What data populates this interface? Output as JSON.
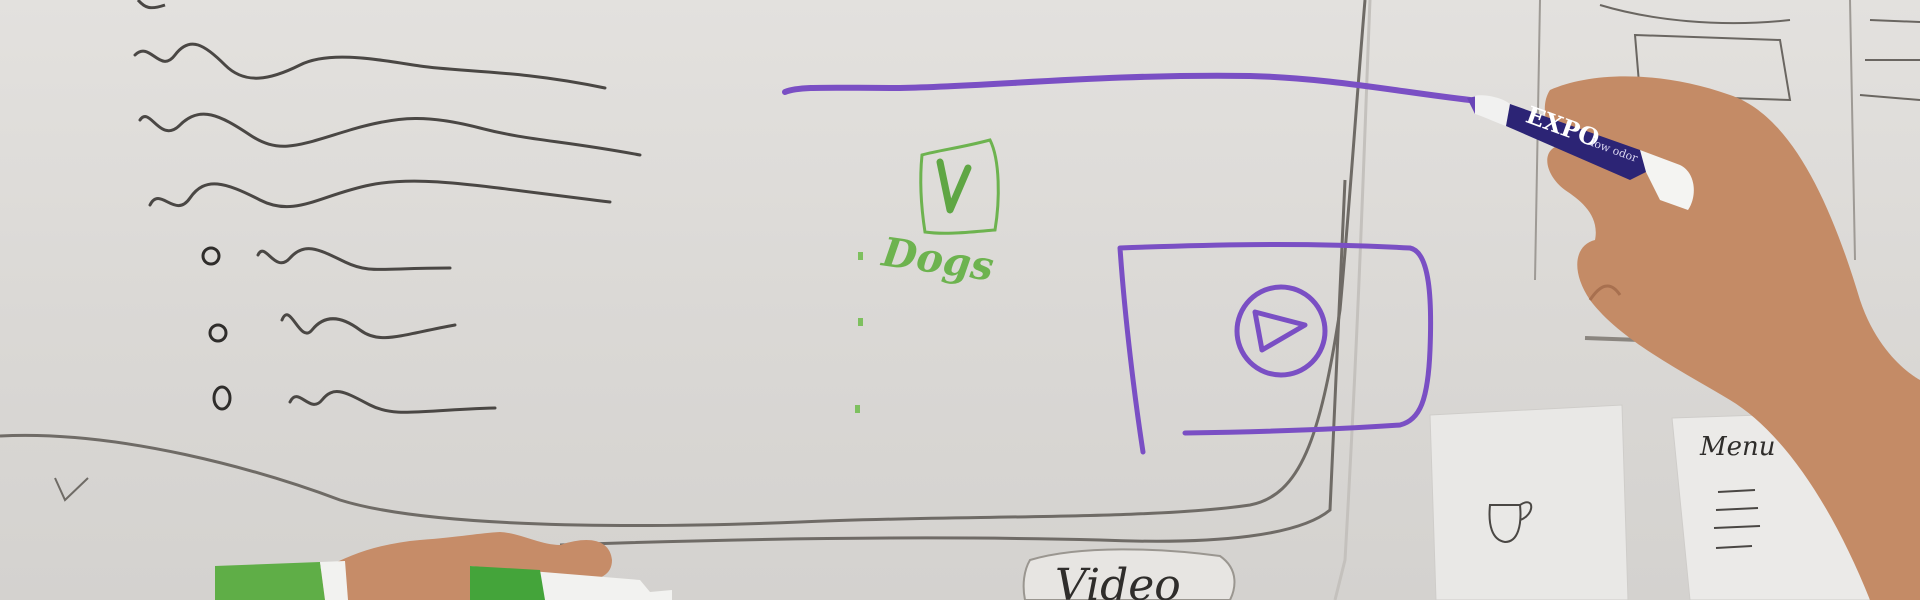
{
  "scene": {
    "description_tag": "whiteboard-ui-wireframe-sketch",
    "colors": {
      "board": "#dcdad7",
      "ink_black": "#4a4744",
      "ink_purple": "#7a4fc4",
      "ink_green": "#6db34f",
      "skin": "#c9906a",
      "note_paper": "#e9e8e6"
    }
  },
  "sketch": {
    "green_label": "Dogs",
    "green_icon_letter": "V",
    "bottom_label": "Video",
    "note_right_label": "Menu",
    "marker_brand": "EXPO",
    "marker_subtext": "low odor"
  }
}
